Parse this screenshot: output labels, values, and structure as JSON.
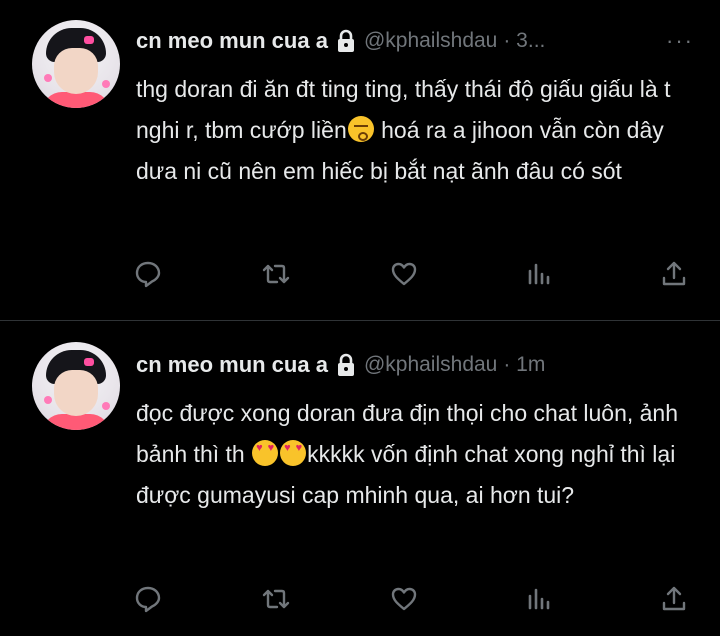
{
  "tweets": [
    {
      "display_name": "cn meo mun cua a",
      "handle": "@kphailshdau",
      "time": "· 3...",
      "more_label": "···",
      "text_parts": {
        "a": "thg doran đi ăn đt ting ting, thấy thái độ giấu giấu là t nghi r, tbm cướp liền",
        "b": " hoá ra a jihoon vẫn còn dây dưa ni cũ nên em hiếc bị bắt nạt ãnh đâu có sót"
      },
      "emoji": [
        "kissing-face-emoji"
      ]
    },
    {
      "display_name": "cn meo mun cua a",
      "handle": "@kphailshdau",
      "time": "· 1m",
      "more_label": "···",
      "text_parts": {
        "a": "đọc được xong doran đưa địn thọi cho chat luôn, ảnh bảnh thì th ",
        "b": "kkkkk vốn định chat xong nghỉ thì lại được gumayusi cap mhinh qua, ai hơn tui?"
      },
      "emoji": [
        "smiling-face-with-heart-eyes-emoji",
        "smiling-face-with-heart-eyes-emoji"
      ]
    }
  ],
  "colors": {
    "background": "#000000",
    "text": "#e7e9ea",
    "secondary": "#71767b",
    "divider": "#2f3336"
  },
  "icons": [
    "lock-icon",
    "reply-icon",
    "retweet-icon",
    "like-icon",
    "analytics-icon",
    "share-icon",
    "more-icon"
  ]
}
